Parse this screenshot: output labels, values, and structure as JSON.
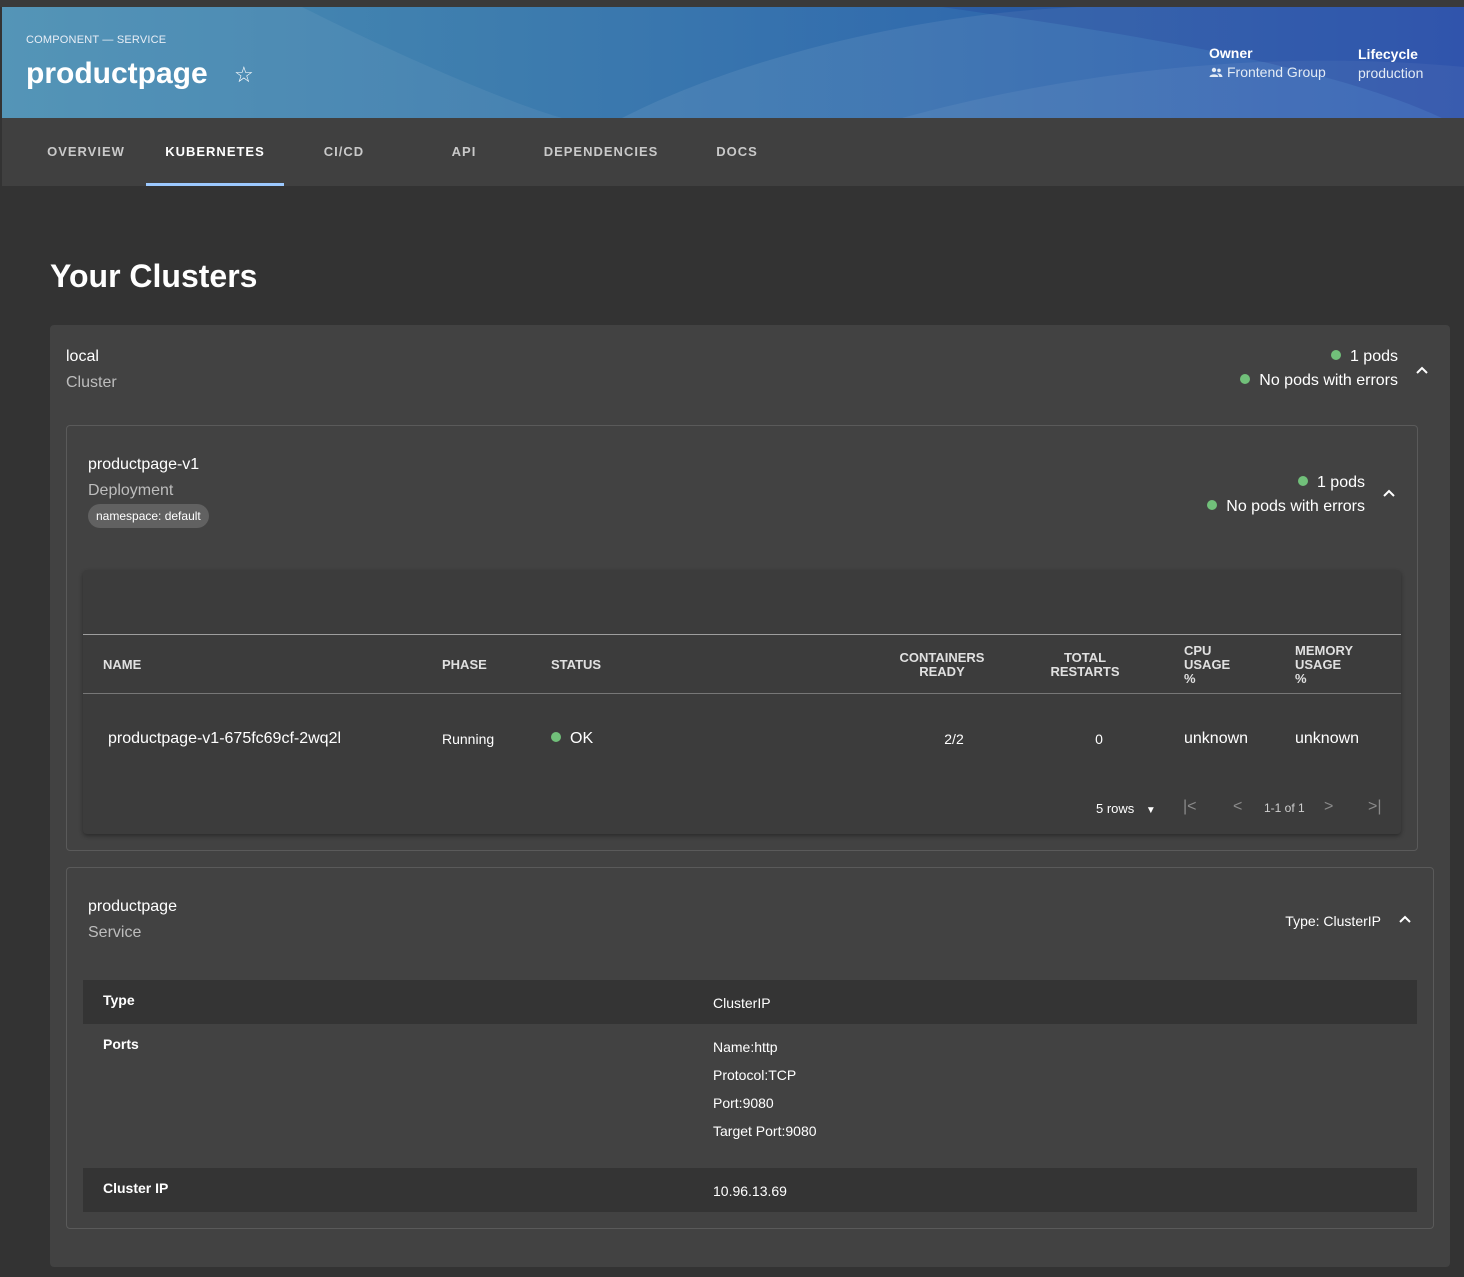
{
  "header": {
    "kind": "COMPONENT — SERVICE",
    "title": "productpage",
    "owner_label": "Owner",
    "owner_value": "Frontend Group",
    "lifecycle_label": "Lifecycle",
    "lifecycle_value": "production"
  },
  "tabs": [
    {
      "label": "OVERVIEW"
    },
    {
      "label": "KUBERNETES",
      "active": true
    },
    {
      "label": "CI/CD"
    },
    {
      "label": "API"
    },
    {
      "label": "DEPENDENCIES"
    },
    {
      "label": "DOCS"
    }
  ],
  "page": {
    "heading": "Your Clusters"
  },
  "cluster": {
    "name": "local",
    "subtitle": "Cluster",
    "pods": "1 pods",
    "errors": "No pods with errors"
  },
  "deployment": {
    "name": "productpage-v1",
    "subtitle": "Deployment",
    "namespace_chip": "namespace: default",
    "pods": "1 pods",
    "errors": "No pods with errors",
    "table": {
      "headers": {
        "name": "NAME",
        "phase": "PHASE",
        "status": "STATUS",
        "containers_1": "CONTAINERS",
        "containers_2": "READY",
        "restarts_1": "TOTAL",
        "restarts_2": "RESTARTS",
        "cpu_1": "CPU",
        "cpu_2": "USAGE",
        "cpu_3": "%",
        "mem_1": "MEMORY",
        "mem_2": "USAGE",
        "mem_3": "%"
      },
      "rows": [
        {
          "name": "productpage-v1-675fc69cf-2wq2l",
          "phase": "Running",
          "status": "OK",
          "containers_ready": "2/2",
          "total_restarts": "0",
          "cpu_usage": "unknown",
          "memory_usage": "unknown"
        }
      ],
      "pagination": {
        "rows_per_page": "5 rows",
        "range": "1-1 of 1"
      }
    }
  },
  "service": {
    "name": "productpage",
    "subtitle": "Service",
    "type_badge": "Type: ClusterIP",
    "details": {
      "type_key": "Type",
      "type_value": "ClusterIP",
      "ports_key": "Ports",
      "ports_values": [
        "Name:http",
        "Protocol:TCP",
        "Port:9080",
        "Target Port:9080"
      ],
      "cluster_ip_key": "Cluster IP",
      "cluster_ip_value": "10.96.13.69"
    }
  },
  "colors": {
    "ok_dot": "#71c07a",
    "tab_indicator": "#9cc9ff",
    "header_start": "#4a8fb3",
    "header_end": "#2552ae"
  }
}
